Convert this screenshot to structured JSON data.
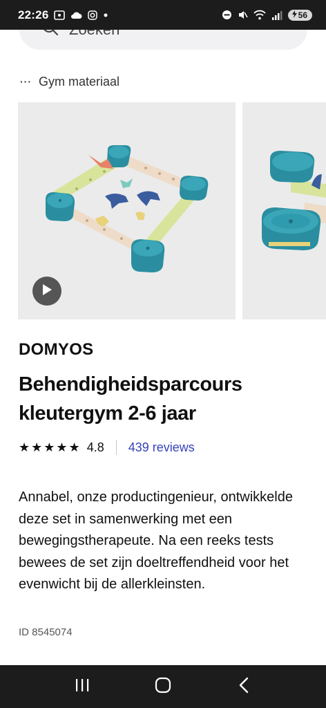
{
  "status_bar": {
    "time": "22:26",
    "battery": "56"
  },
  "search": {
    "placeholder": "Zoeken"
  },
  "breadcrumb": {
    "dots": "···",
    "label": "Gym materiaal"
  },
  "product": {
    "brand": "DOMYOS",
    "title": "Behendigheidsparcours kleutergym 2-6 jaar",
    "stars": "★★★★★",
    "rating": "4.8",
    "reviews": "439 reviews",
    "description": "Annabel, onze productingenieur, ontwikkelde deze set in samenwerking met een bewegingstherapeute. Na een reeks tests bewees de set zijn doeltreffendheid voor het evenwicht bij de allerkleinsten.",
    "id": "ID 8545074"
  },
  "colors": {
    "accent": "#3643ba",
    "block_teal": "#2e93a6",
    "beam_green": "#d6e59a",
    "beam_beige": "#efdcc6"
  }
}
